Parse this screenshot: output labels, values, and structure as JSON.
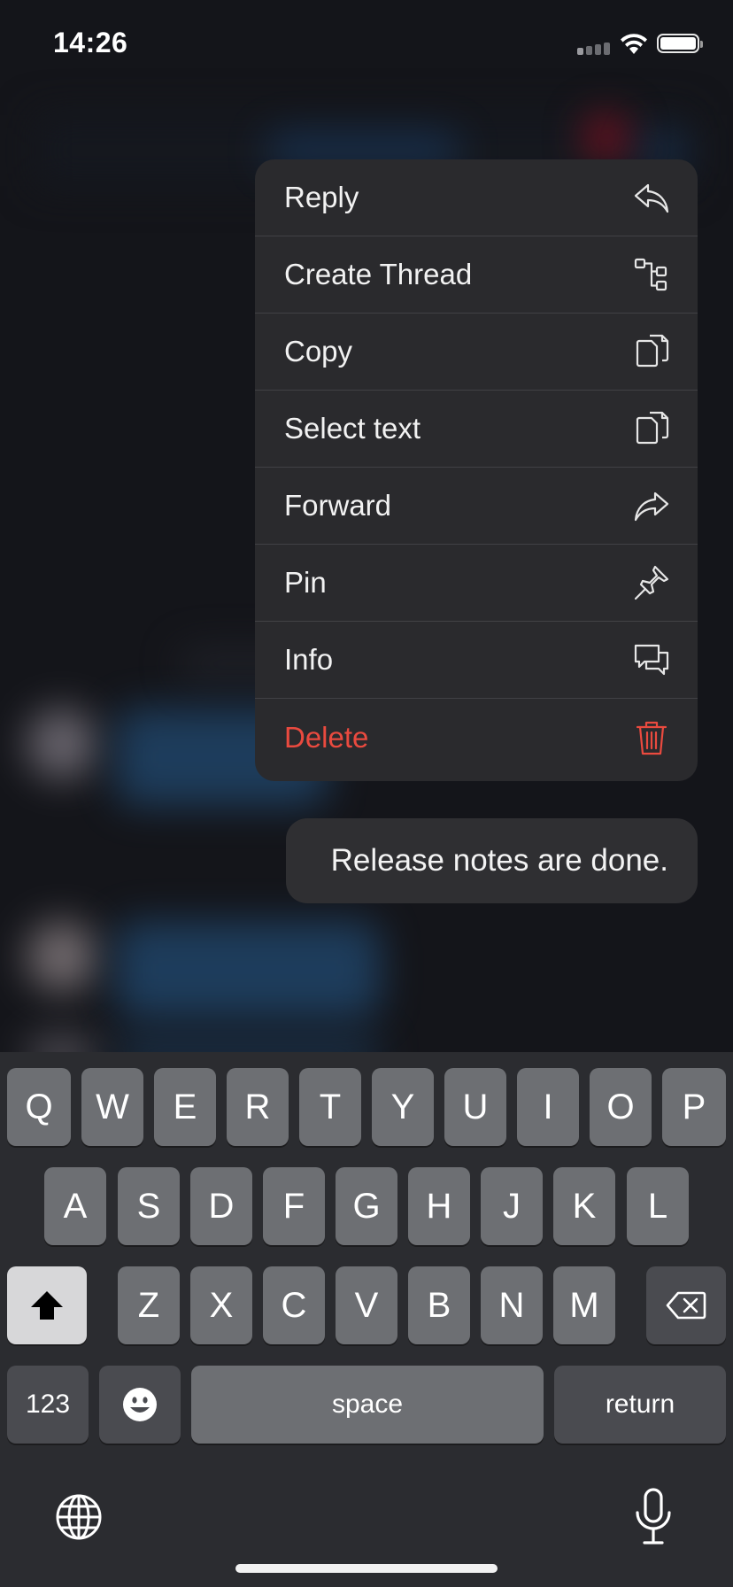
{
  "status_bar": {
    "time": "14:26"
  },
  "context_menu": {
    "items": [
      {
        "label": "Reply",
        "icon": "reply-icon"
      },
      {
        "label": "Create Thread",
        "icon": "thread-icon"
      },
      {
        "label": "Copy",
        "icon": "copy-icon"
      },
      {
        "label": "Select text",
        "icon": "copy-icon"
      },
      {
        "label": "Forward",
        "icon": "forward-icon"
      },
      {
        "label": "Pin",
        "icon": "pin-icon"
      },
      {
        "label": "Info",
        "icon": "info-chat-icon"
      },
      {
        "label": "Delete",
        "icon": "trash-icon",
        "color": "#ea4a3f"
      }
    ]
  },
  "message": {
    "text": "Release notes are done."
  },
  "keyboard": {
    "row1": [
      "Q",
      "W",
      "E",
      "R",
      "T",
      "Y",
      "U",
      "I",
      "O",
      "P"
    ],
    "row2": [
      "A",
      "S",
      "D",
      "F",
      "G",
      "H",
      "J",
      "K",
      "L"
    ],
    "row3": [
      "Z",
      "X",
      "C",
      "V",
      "B",
      "N",
      "M"
    ],
    "numbers_label": "123",
    "space_label": "space",
    "return_label": "return"
  }
}
